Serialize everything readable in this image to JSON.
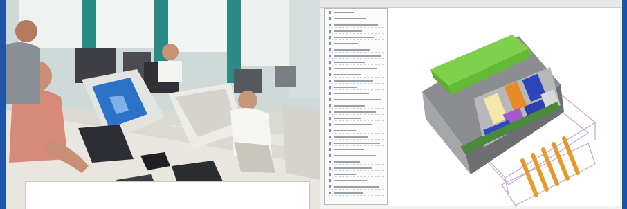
{
  "photo": {
    "caption": ""
  },
  "cad": {
    "tree_items": [
      1,
      2,
      3,
      4,
      5,
      6,
      7,
      8,
      9,
      10,
      11,
      12,
      13,
      14,
      15,
      16,
      17,
      18,
      19,
      20,
      21,
      22,
      23,
      24,
      25,
      26,
      27,
      28,
      29,
      30
    ]
  }
}
